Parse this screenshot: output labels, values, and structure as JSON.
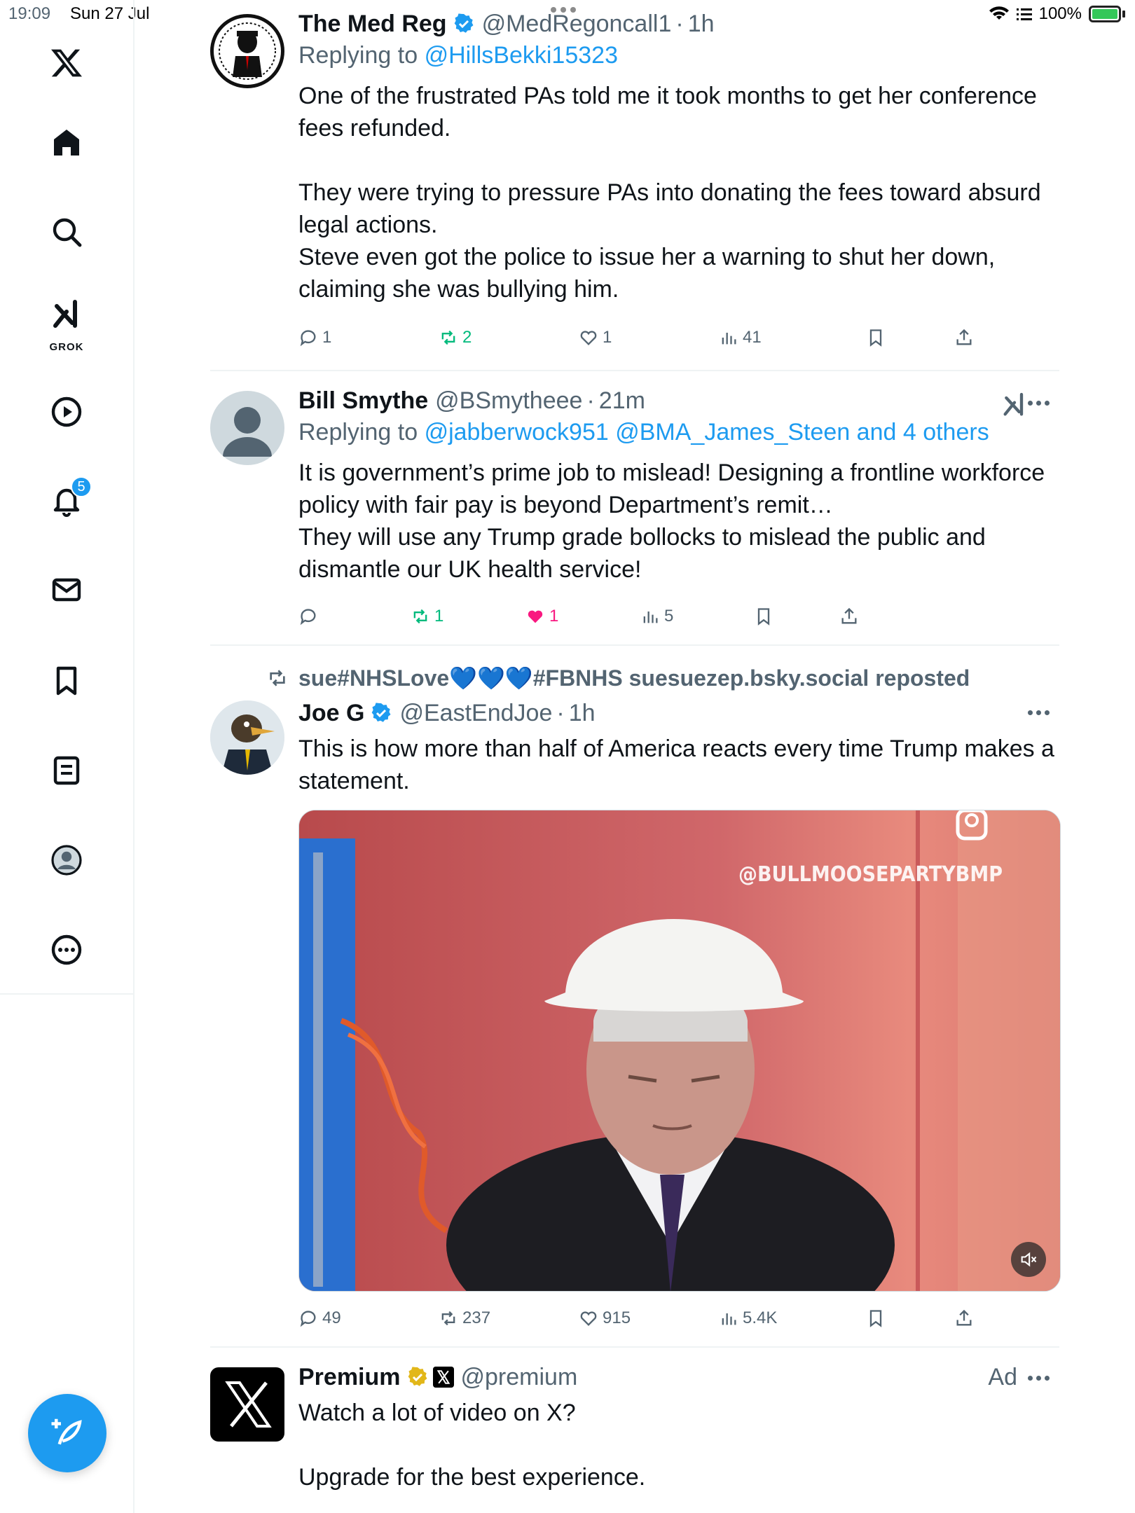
{
  "status_bar": {
    "time": "19:09",
    "date": "Sun 27 Jul",
    "battery": "100%"
  },
  "sidebar": {
    "items": [
      {
        "name": "x-logo-icon"
      },
      {
        "name": "home-icon"
      },
      {
        "name": "search-icon"
      },
      {
        "name": "grok-icon",
        "label": "GROK"
      },
      {
        "name": "video-icon"
      },
      {
        "name": "notifications-icon",
        "badge": "5"
      },
      {
        "name": "messages-icon"
      },
      {
        "name": "bookmarks-icon"
      },
      {
        "name": "lists-icon"
      },
      {
        "name": "profile-icon"
      },
      {
        "name": "more-icon"
      }
    ],
    "accent": "#1d9bf0"
  },
  "tweets": [
    {
      "name": "The Med Reg",
      "handle": "@MedRegoncall1",
      "time": "1h",
      "reply_prefix": "Replying to",
      "reply_to": "@HillsBekki15323",
      "text": "One of the frustrated PAs told me it took months to get her conference fees refunded.\n\nThey were trying to pressure PAs into donating the fees toward absurd legal actions.\nSteve even got the police to issue her a warning to shut her down, claiming she was bullying him.",
      "replies": "1",
      "reposts": "2",
      "likes": "1",
      "views": "41"
    },
    {
      "name": "Bill Smythe",
      "handle": "@BSmytheee",
      "time": "21m",
      "reply_prefix": "Replying to",
      "reply_to": "@jabberwock951 @BMA_James_Steen and 4 others",
      "text": "It is government’s prime job to mislead! Designing a frontline workforce policy with fair pay is beyond Department’s remit…\nThey will use any Trump grade bollocks to mislead the public and dismantle our UK health service!",
      "replies": "",
      "reposts": "1",
      "likes": "1",
      "views": "5"
    },
    {
      "repost_by": "sue#NHSLove💙💙💙#FBNHS suesuezep.bsky.social reposted",
      "name": "Joe G",
      "handle": "@EastEndJoe",
      "time": "1h",
      "text": "This is how more than half of America reacts every time Trump makes a statement.",
      "video_watermark": "@BULLMOOSEPARTYBMP",
      "replies": "49",
      "reposts": "237",
      "likes": "915",
      "views": "5.4K"
    },
    {
      "name": "Premium",
      "handle": "@premium",
      "ad_label": "Ad",
      "text": "Watch a lot of video on X?\n\nUpgrade for the best experience."
    }
  ],
  "colors": {
    "blue": "#1d9bf0",
    "green": "#00ba7c",
    "pink": "#f91880",
    "gray": "#536471",
    "gold": "#e2b719"
  }
}
